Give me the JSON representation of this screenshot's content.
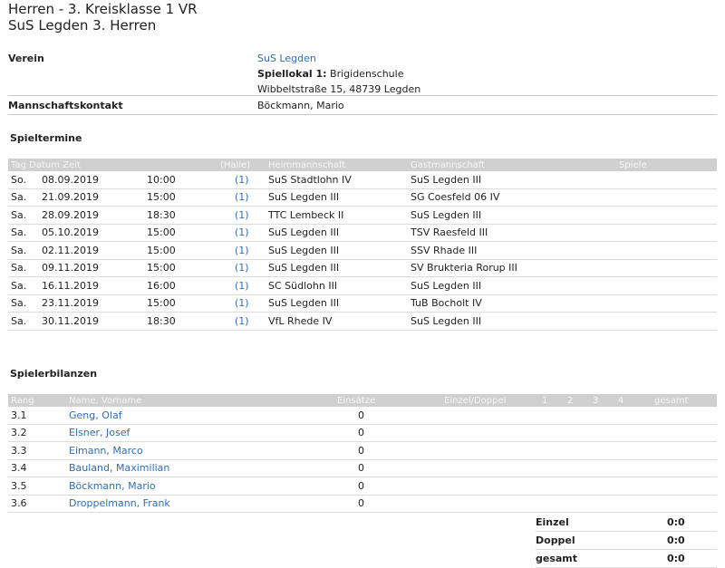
{
  "header": {
    "league": "Herren - 3. Kreisklasse 1 VR",
    "team": "SuS Legden 3. Herren"
  },
  "info": {
    "verein_label": "Verein",
    "verein_name": "SuS Legden",
    "spiellokal_label": "Spiellokal 1:",
    "spiellokal_name": "Brigidenschule",
    "address": "Wibbeltstraße 15, 48739 Legden",
    "kontakt_label": "Mannschaftskontakt",
    "kontakt_name": "Böckmann, Mario"
  },
  "spieltermine": {
    "title": "Spieltermine",
    "headers": [
      "Tag Datum Zeit",
      "(Halle)",
      "Heimmannschaft",
      "Gastmannschaft",
      "Spiele"
    ],
    "rows": [
      {
        "tag": "So.",
        "datum": "08.09.2019",
        "zeit": "10:00",
        "halle": "(1)",
        "heim": "SuS Stadtlohn IV",
        "gast": "SuS Legden III"
      },
      {
        "tag": "Sa.",
        "datum": "21.09.2019",
        "zeit": "15:00",
        "halle": "(1)",
        "heim": "SuS Legden III",
        "gast": "SG Coesfeld 06 IV"
      },
      {
        "tag": "Sa.",
        "datum": "28.09.2019",
        "zeit": "18:30",
        "halle": "(1)",
        "heim": "TTC Lembeck II",
        "gast": "SuS Legden III"
      },
      {
        "tag": "Sa.",
        "datum": "05.10.2019",
        "zeit": "15:00",
        "halle": "(1)",
        "heim": "SuS Legden III",
        "gast": "TSV Raesfeld III"
      },
      {
        "tag": "Sa.",
        "datum": "02.11.2019",
        "zeit": "15:00",
        "halle": "(1)",
        "heim": "SuS Legden III",
        "gast": "SSV Rhade III"
      },
      {
        "tag": "Sa.",
        "datum": "09.11.2019",
        "zeit": "15:00",
        "halle": "(1)",
        "heim": "SuS Legden III",
        "gast": "SV Brukteria Rorup III"
      },
      {
        "tag": "Sa.",
        "datum": "16.11.2019",
        "zeit": "16:00",
        "halle": "(1)",
        "heim": "SC Südlohn III",
        "gast": "SuS Legden III"
      },
      {
        "tag": "Sa.",
        "datum": "23.11.2019",
        "zeit": "15:00",
        "halle": "(1)",
        "heim": "SuS Legden III",
        "gast": "TuB Bocholt IV"
      },
      {
        "tag": "Sa.",
        "datum": "30.11.2019",
        "zeit": "18:30",
        "halle": "(1)",
        "heim": "VfL Rhede IV",
        "gast": "SuS Legden III"
      }
    ]
  },
  "spielerbilanzen": {
    "title": "Spielerbilanzen",
    "headers": [
      "Rang",
      "Name, Vorname",
      "Einsätze",
      "Einzel/Doppel",
      "1",
      "2",
      "3",
      "4",
      "gesamt"
    ],
    "rows": [
      {
        "rang": "3.1",
        "name": "Geng, Olaf",
        "einsaetze": "0"
      },
      {
        "rang": "3.2",
        "name": "Elsner, Josef",
        "einsaetze": "0"
      },
      {
        "rang": "3.3",
        "name": "Eimann, Marco",
        "einsaetze": "0"
      },
      {
        "rang": "3.4",
        "name": "Bauland, Maximilian",
        "einsaetze": "0"
      },
      {
        "rang": "3.5",
        "name": "Böckmann, Mario",
        "einsaetze": "0"
      },
      {
        "rang": "3.6",
        "name": "Droppelmann, Frank",
        "einsaetze": "0"
      }
    ],
    "summary": [
      {
        "label": "Einzel",
        "value": "0:0"
      },
      {
        "label": "Doppel",
        "value": "0:0"
      },
      {
        "label": "gesamt",
        "value": "0:0"
      }
    ]
  }
}
